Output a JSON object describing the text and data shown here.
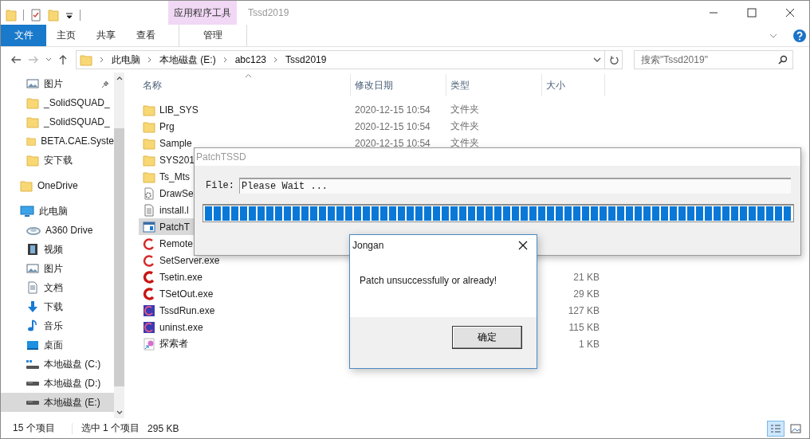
{
  "window": {
    "title": "Tssd2019",
    "contextual_group": "应用程序工具"
  },
  "ribbon_tabs": [
    {
      "label": "文件",
      "kind": "file"
    },
    {
      "label": "主页",
      "kind": "normal"
    },
    {
      "label": "共享",
      "kind": "normal"
    },
    {
      "label": "查看",
      "kind": "normal"
    },
    {
      "label": "管理",
      "kind": "contextual"
    }
  ],
  "address": {
    "path": [
      "此电脑",
      "本地磁盘 (E:)",
      "abc123",
      "Tssd2019"
    ]
  },
  "search": {
    "placeholder": "搜索\"Tssd2019\""
  },
  "sidebar": {
    "quick_access": [
      {
        "label": "图片",
        "kind": "pictures",
        "pinned": true,
        "selected": false
      },
      {
        "label": "_SolidSQUAD_",
        "kind": "folder",
        "pinned": false,
        "selected": false
      },
      {
        "label": "_SolidSQUAD_",
        "kind": "folder",
        "pinned": false,
        "selected": false
      },
      {
        "label": "BETA.CAE.Syste",
        "kind": "folder",
        "pinned": false,
        "selected": false
      },
      {
        "label": "安下载",
        "kind": "folder",
        "pinned": false,
        "selected": false
      }
    ],
    "items": [
      {
        "label": "OneDrive",
        "kind": "folder",
        "selected": false
      },
      {
        "label": "此电脑",
        "kind": "pc",
        "selected": false,
        "children": [
          {
            "label": "A360 Drive",
            "kind": "cloud",
            "selected": false
          },
          {
            "label": "视频",
            "kind": "video",
            "selected": false
          },
          {
            "label": "图片",
            "kind": "pictures",
            "selected": false
          },
          {
            "label": "文档",
            "kind": "documents",
            "selected": false
          },
          {
            "label": "下载",
            "kind": "download",
            "selected": false
          },
          {
            "label": "音乐",
            "kind": "music",
            "selected": false
          },
          {
            "label": "桌面",
            "kind": "desktop",
            "selected": false
          },
          {
            "label": "本地磁盘 (C:)",
            "kind": "system-drive",
            "selected": false
          },
          {
            "label": "本地磁盘 (D:)",
            "kind": "drive",
            "selected": false
          },
          {
            "label": "本地磁盘 (E:)",
            "kind": "drive",
            "selected": true
          }
        ]
      }
    ]
  },
  "columns": [
    {
      "label": "名称",
      "sorted": true
    },
    {
      "label": "修改日期",
      "sorted": false
    },
    {
      "label": "类型",
      "sorted": false
    },
    {
      "label": "大小",
      "sorted": false
    }
  ],
  "files": [
    {
      "name": "LIB_SYS",
      "kind": "folder",
      "date": "2020-12-15 10:54",
      "type": "文件夹",
      "selected": false
    },
    {
      "name": "Prg",
      "kind": "folder",
      "date": "2020-12-15 10:54",
      "type": "文件夹",
      "selected": false
    },
    {
      "name": "Sample",
      "kind": "folder",
      "date": "2020-12-15 10:54",
      "type": "文件夹",
      "selected": false
    },
    {
      "name": "SYS201",
      "kind": "folder",
      "selected": false
    },
    {
      "name": "Ts_Mts",
      "kind": "folder",
      "selected": false
    },
    {
      "name": "DrawSe",
      "kind": "settings-file",
      "selected": false
    },
    {
      "name": "install.l",
      "kind": "text-file",
      "selected": false
    },
    {
      "name": "PatchT",
      "kind": "app-window",
      "selected": true
    },
    {
      "name": "Remote",
      "kind": "swirl",
      "selected": false
    },
    {
      "name": "SetServer.exe",
      "kind": "swirl",
      "selected": false
    },
    {
      "name": "Tsetin.exe",
      "kind": "swirl-bold",
      "size": "21 KB",
      "selected": false
    },
    {
      "name": "TSetOut.exe",
      "kind": "swirl-bold",
      "size": "29 KB",
      "selected": false
    },
    {
      "name": "TssdRun.exe",
      "kind": "blue-app",
      "size": "127 KB",
      "selected": false
    },
    {
      "name": "uninst.exe",
      "kind": "blue-app",
      "size": "115 KB",
      "selected": false
    },
    {
      "name": "探索者",
      "kind": "shortcut",
      "size": "1 KB",
      "selected": false
    }
  ],
  "status_bar": {
    "count": "15 个项目",
    "selection": "选中 1 个项目",
    "size": "295 KB"
  },
  "view_buttons": [
    {
      "kind": "details",
      "selected": true
    },
    {
      "kind": "large-icons",
      "selected": false
    }
  ],
  "patch_dialog": {
    "title": "PatchTSSD",
    "file_label": "File:",
    "file_value": "Please Wait ...",
    "progress": {
      "level": 1
    }
  },
  "message_dialog": {
    "title": "Jongan",
    "message": "Patch unsuccessfully or already!",
    "button": "确定"
  }
}
